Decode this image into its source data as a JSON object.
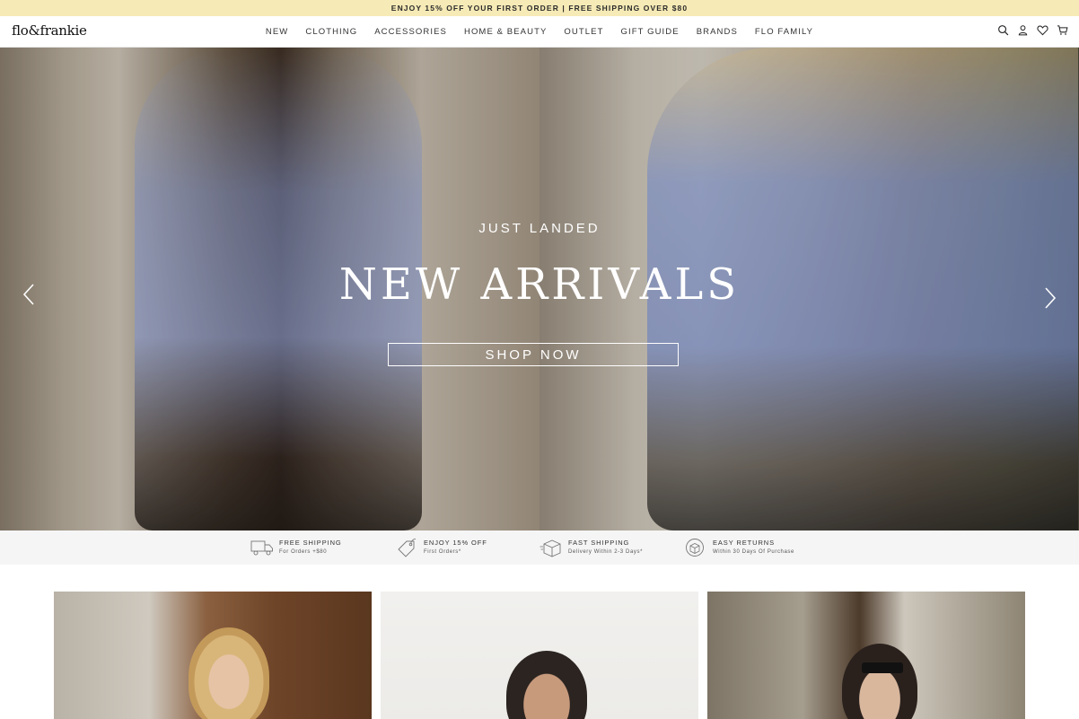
{
  "promo": {
    "text": "ENJOY 15% OFF YOUR FIRST ORDER | FREE SHIPPING OVER $80"
  },
  "header": {
    "logo": "flo&frankie",
    "nav": [
      "NEW",
      "CLOTHING",
      "ACCESSORIES",
      "HOME & BEAUTY",
      "OUTLET",
      "GIFT GUIDE",
      "BRANDS",
      "FLO FAMILY"
    ],
    "icons": [
      "search-icon",
      "account-icon",
      "wishlist-icon",
      "cart-icon"
    ]
  },
  "hero": {
    "subtitle": "JUST LANDED",
    "title": "NEW ARRIVALS",
    "cta": "SHOP NOW"
  },
  "features": [
    {
      "icon": "truck-icon",
      "title": "FREE SHIPPING",
      "sub": "For Orders +$80"
    },
    {
      "icon": "tag-icon",
      "title": "ENJOY 15% OFF",
      "sub": "First Orders*"
    },
    {
      "icon": "box-icon",
      "title": "FAST SHIPPING",
      "sub": "Delivery Within 2-3 Days*"
    },
    {
      "icon": "returns-icon",
      "title": "EASY RETURNS",
      "sub": "Within 30 Days Of Purchase"
    }
  ]
}
